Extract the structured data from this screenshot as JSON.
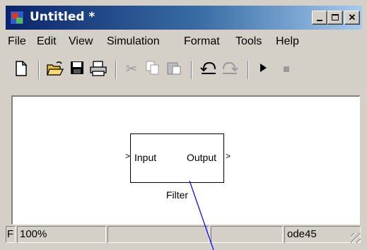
{
  "window": {
    "title": "Untitled *"
  },
  "menu": {
    "items": [
      "File",
      "Edit",
      "View",
      "Simulation",
      "Format",
      "Tools",
      "Help"
    ]
  },
  "toolbar": {
    "icons": [
      "new-icon",
      "open-icon",
      "save-icon",
      "print-icon",
      "cut-icon",
      "copy-icon",
      "paste-icon",
      "undo-icon",
      "redo-icon",
      "run-icon",
      "stop-icon"
    ]
  },
  "block": {
    "input_label": "Input",
    "output_label": "Output",
    "name": "Filter"
  },
  "status": {
    "left_label": "F",
    "zoom": "100%",
    "cell2": "",
    "cell3": "",
    "solver": "ode45"
  },
  "colors": {
    "title_bar_start": "#0a246a",
    "title_bar_end": "#a6caf0",
    "signal_line": "#0000ff"
  }
}
